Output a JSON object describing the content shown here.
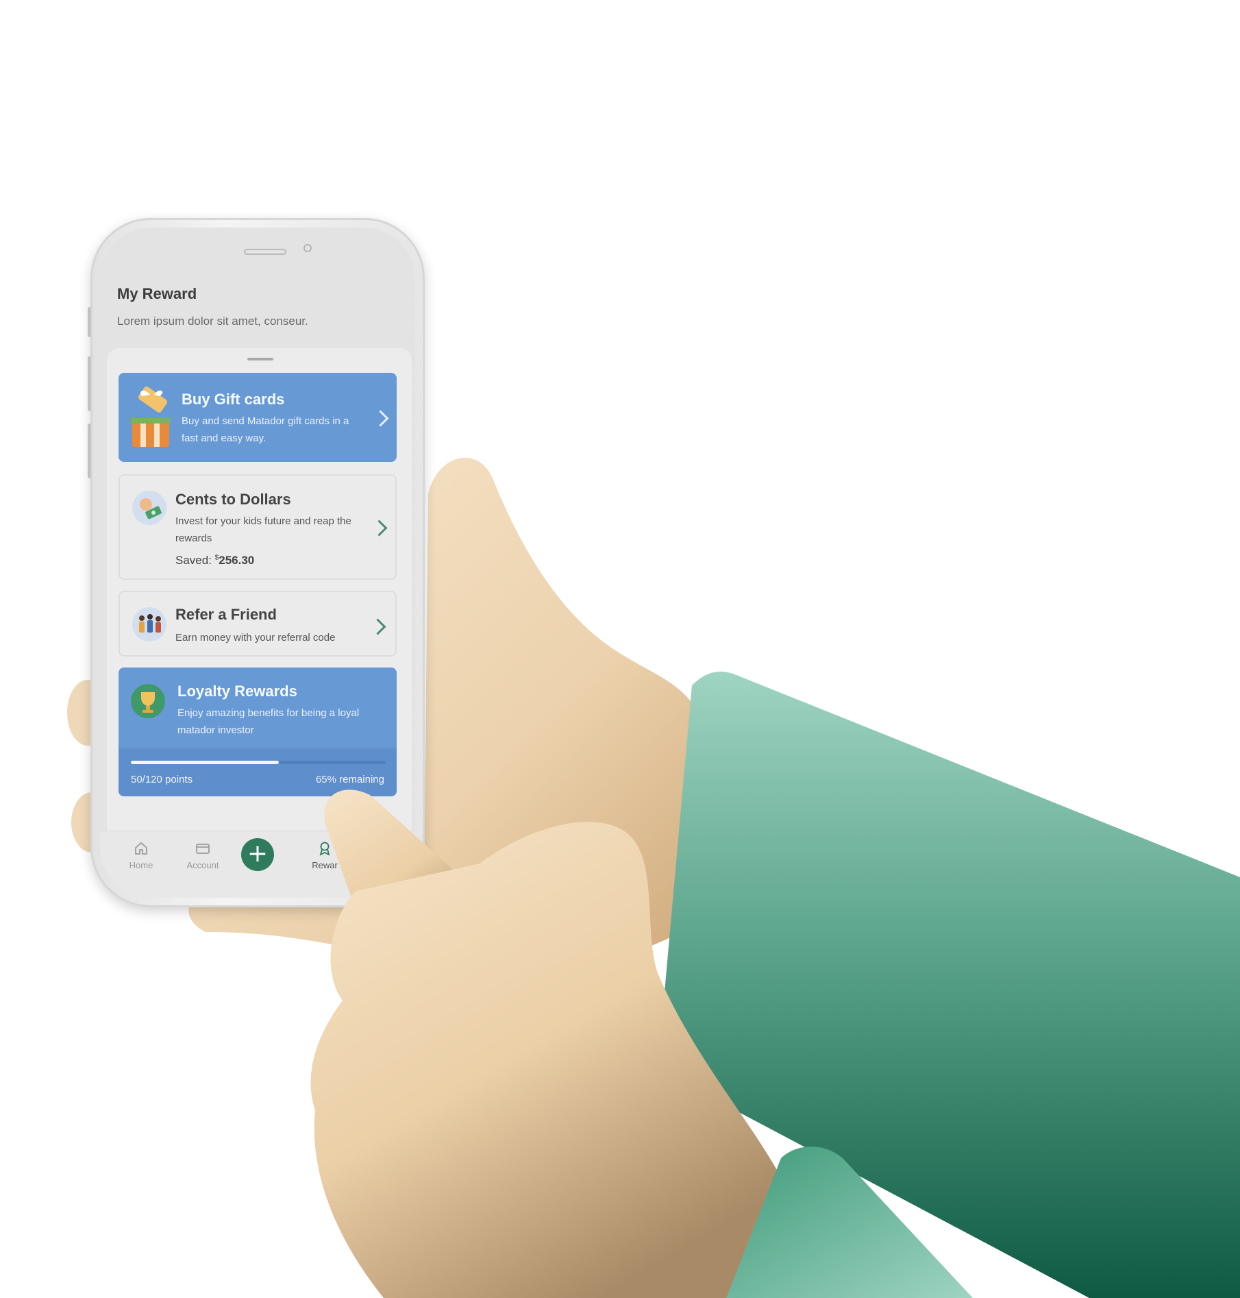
{
  "screen": {
    "title": "My Reward",
    "subtitle": "Lorem ipsum dolor sit amet, conseur."
  },
  "cards": {
    "gift": {
      "title": "Buy Gift cards",
      "desc_line1": "Buy and send Matador gift cards in a",
      "desc_line2": "fast and easy way.",
      "icon": "gift-box-icon"
    },
    "cents": {
      "title": "Cents to Dollars",
      "desc_line1": "Invest for your kids future and reap the",
      "desc_line2": "rewards",
      "saved_label": "Saved:",
      "saved_currency": "$",
      "saved_value": "256.30",
      "icon": "money-jar-icon"
    },
    "refer": {
      "title": "Refer a Friend",
      "desc": "Earn money with your referral code",
      "icon": "friends-group-icon"
    },
    "loyalty": {
      "title": "Loyalty Rewards",
      "desc_line1": "Enjoy amazing benefits for being a loyal",
      "desc_line2": "matador investor",
      "points_label": "50/120 points",
      "remaining_label": "65% remaining",
      "progress_fraction": 0.58,
      "icon": "trophy-icon"
    }
  },
  "tabs": {
    "home": "Home",
    "account": "Account",
    "add": "+",
    "rewards": "Rewar"
  },
  "colors": {
    "accent_blue": "#6799d5",
    "accent_green": "#2f7b5d",
    "sleeve_green": "#3f9a7a",
    "skin": "#f0d5b3"
  }
}
